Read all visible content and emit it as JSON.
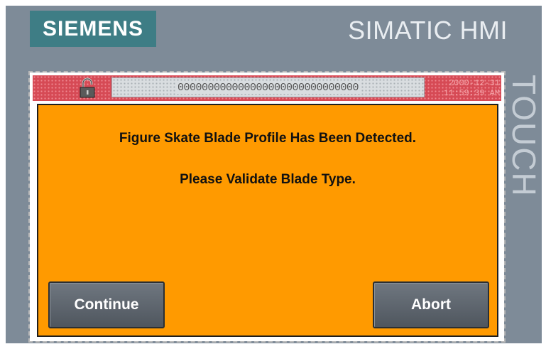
{
  "panel": {
    "brand": "SIEMENS",
    "product": "SIMATIC HMI",
    "side_label": "TOUCH"
  },
  "statusbar": {
    "lock_icon": "padlock-open-icon",
    "ticker_text": "000000000000000000000000000000",
    "date": "2000-12-31",
    "time": "11:59:39 AM"
  },
  "dialog": {
    "message_line1": "Figure Skate Blade Profile Has Been Detected.",
    "message_line2": "Please Validate Blade Type.",
    "continue_label": "Continue",
    "abort_label": "Abort"
  },
  "colors": {
    "dialog_background": "#ff9a00",
    "statusbar_background": "#d64a55",
    "bezel": "#7e8b98",
    "brand_accent": "#3e7d85",
    "button": "#5f666e"
  }
}
